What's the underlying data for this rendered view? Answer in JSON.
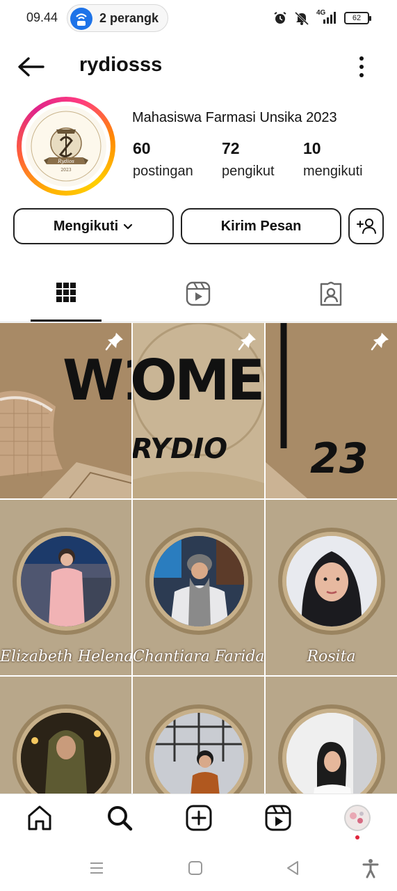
{
  "status_bar": {
    "time": "09.44",
    "hotspot_label": "2 perangk",
    "network": "4G",
    "battery": "62",
    "icons": [
      "hotspot-icon",
      "alarm-icon",
      "mute-icon",
      "signal-icon",
      "battery-icon"
    ]
  },
  "header": {
    "username": "rydiosss",
    "back_icon": "arrow-left-icon",
    "more_icon": "vertical-dots-icon"
  },
  "profile": {
    "bio": "Mahasiswa Farmasi Unsika 2023",
    "stats": [
      {
        "value": "60",
        "label": "postingan"
      },
      {
        "value": "72",
        "label": "pengikut"
      },
      {
        "value": "10",
        "label": "mengikuti"
      }
    ],
    "avatar_logo_text": "Rydios 2023"
  },
  "actions": {
    "following_label": "Mengikuti",
    "message_label": "Kirim Pesan",
    "add_person_icon": "add-person-icon"
  },
  "tabs": [
    {
      "name": "grid",
      "icon": "grid-icon",
      "active": true
    },
    {
      "name": "reels",
      "icon": "reels-icon",
      "active": false
    },
    {
      "name": "tagged",
      "icon": "tagged-person-icon",
      "active": false
    }
  ],
  "posts": {
    "pinned_banner": [
      "W1C",
      "OME",
      "RYDIO",
      "23"
    ],
    "captions": [
      "Elizabeth Helena",
      "Chantiara Farida",
      "Rosita"
    ]
  },
  "bottom_nav": [
    "home-icon",
    "search-icon",
    "create-icon",
    "reels-icon",
    "profile-avatar-icon"
  ],
  "system_nav": [
    "recents-icon",
    "home-square-icon",
    "back-triangle-icon",
    "accessibility-icon"
  ],
  "colors": {
    "story_ring": [
      "#ffb300",
      "#e0248a"
    ],
    "hotspot_blue": "#1e73e8",
    "tile_paper": "#b8a78a"
  }
}
